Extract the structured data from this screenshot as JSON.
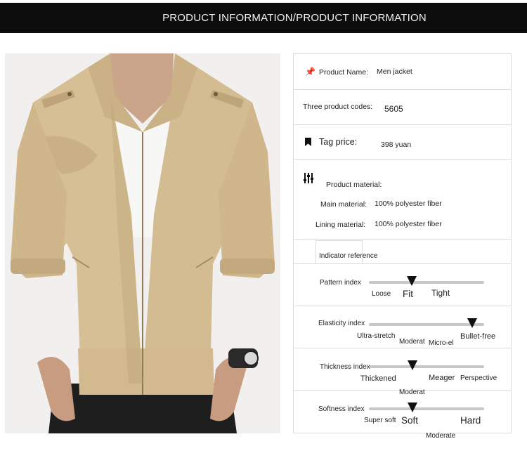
{
  "header": {
    "title": "PRODUCT INFORMATION/PRODUCT INFORMATION"
  },
  "product": {
    "name_label": "Product Name:",
    "name_value": "Men jacket",
    "codes_label": "Three product codes:",
    "codes_value": "5605",
    "price_label": "Tag price:",
    "price_value": "398 yuan",
    "material_label": "Product material:",
    "main_material_label": "Main material:",
    "main_material_value": "100% polyester fiber",
    "lining_label": "Lining material:",
    "lining_value": "100% polyester fiber"
  },
  "indicator": {
    "tab_label": "Indicator reference",
    "pattern": {
      "label": "Pattern index",
      "options": [
        "Loose",
        "Fit",
        "Tight"
      ],
      "selected": "Fit",
      "level": 0.37
    },
    "elasticity": {
      "label": "Elasticity index",
      "options": [
        "Ultra-stretch",
        "Moderat",
        "Micro-el",
        "Bullet-free"
      ],
      "selected": "Bullet-free",
      "level": 0.89
    },
    "thickness": {
      "label": "Thickness index",
      "options": [
        "Thickened",
        "Moderat",
        "Meager",
        "Perspective"
      ],
      "selected": "Moderat",
      "level": 0.37
    },
    "softness": {
      "label": "Softness index",
      "options": [
        "Super soft",
        "Soft",
        "Moderate",
        "Hard"
      ],
      "selected": "Soft",
      "level": 0.37
    }
  },
  "colors": {
    "jacket": "#d6bf95",
    "jacket_shadow": "#b9a074",
    "header_bg": "#0d0d0d",
    "track": "#c8c8c8"
  },
  "icons": {
    "name": "pin-icon",
    "price": "bookmark-icon",
    "material": "sliders-icon"
  }
}
